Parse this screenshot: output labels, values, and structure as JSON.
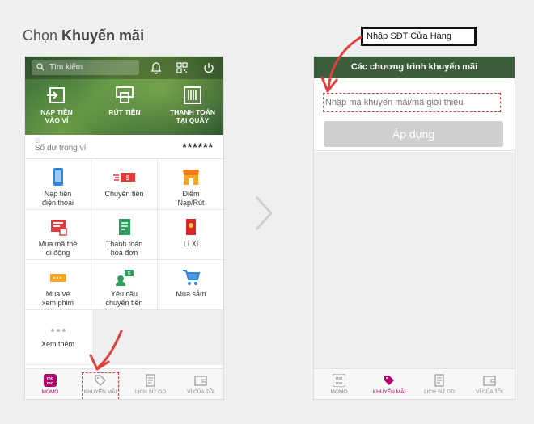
{
  "heading": {
    "prefix": "Chọn ",
    "bold": "Khuyến mãi"
  },
  "left_phone": {
    "search_placeholder": "Tìm kiếm",
    "hero_actions": [
      {
        "label_line1": "NẠP TIỀN",
        "label_line2": "VÀO VÍ",
        "icon": "wallet-in-icon"
      },
      {
        "label_line1": "RÚT TIỀN",
        "label_line2": "",
        "icon": "atm-withdraw-icon"
      },
      {
        "label_line1": "THANH TOÁN",
        "label_line2": "TẠI QUẦY",
        "icon": "barcode-icon"
      }
    ],
    "balance": {
      "label": "Số dư trong ví",
      "value": "******"
    },
    "services": [
      {
        "line1": "Nạp tiền",
        "line2": "điện thoại",
        "icon": "phone-icon"
      },
      {
        "line1": "Chuyển tiền",
        "line2": "",
        "icon": "money-transfer-icon"
      },
      {
        "line1": "Điểm",
        "line2": "Nạp/Rút",
        "icon": "store-icon"
      },
      {
        "line1": "Mua mã thẻ",
        "line2": "di động",
        "icon": "card-code-icon"
      },
      {
        "line1": "Thanh toán",
        "line2": "hoá đơn",
        "icon": "bill-icon"
      },
      {
        "line1": "Lì Xì",
        "line2": "",
        "icon": "red-envelope-icon"
      },
      {
        "line1": "Mua vé",
        "line2": "xem phim",
        "icon": "ticket-icon"
      },
      {
        "line1": "Yêu cầu",
        "line2": "chuyển tiền",
        "icon": "request-money-icon"
      },
      {
        "line1": "Mua sắm",
        "line2": "",
        "icon": "cart-icon"
      },
      {
        "line1": "Xem thêm",
        "line2": "",
        "icon": "more-dots-icon"
      }
    ],
    "bottom_nav": [
      {
        "label": "MOMO",
        "active": true
      },
      {
        "label": "KHUYẾN MÃI",
        "active": false
      },
      {
        "label": "LỊCH SỬ GD",
        "active": false
      },
      {
        "label": "VÍ CỦA TÔI",
        "active": false
      }
    ]
  },
  "right_phone": {
    "header_title": "Các chương trình khuyến mãi",
    "promo_placeholder": "Nhập mã khuyến mãi/mã giới thiệu",
    "apply_label": "Áp dụng",
    "bottom_nav": [
      {
        "label": "MOMO",
        "active": false
      },
      {
        "label": "KHUYẾN MÃI",
        "active": true
      },
      {
        "label": "LỊCH SỬ GD",
        "active": false
      },
      {
        "label": "VÍ CỦA TÔI",
        "active": false
      }
    ]
  },
  "callout": {
    "text": "Nhập SĐT Cửa Hàng"
  },
  "colors": {
    "momo_pink": "#b0006d",
    "header_green": "#3d5e3d",
    "annotation_red": "#e0403a"
  }
}
